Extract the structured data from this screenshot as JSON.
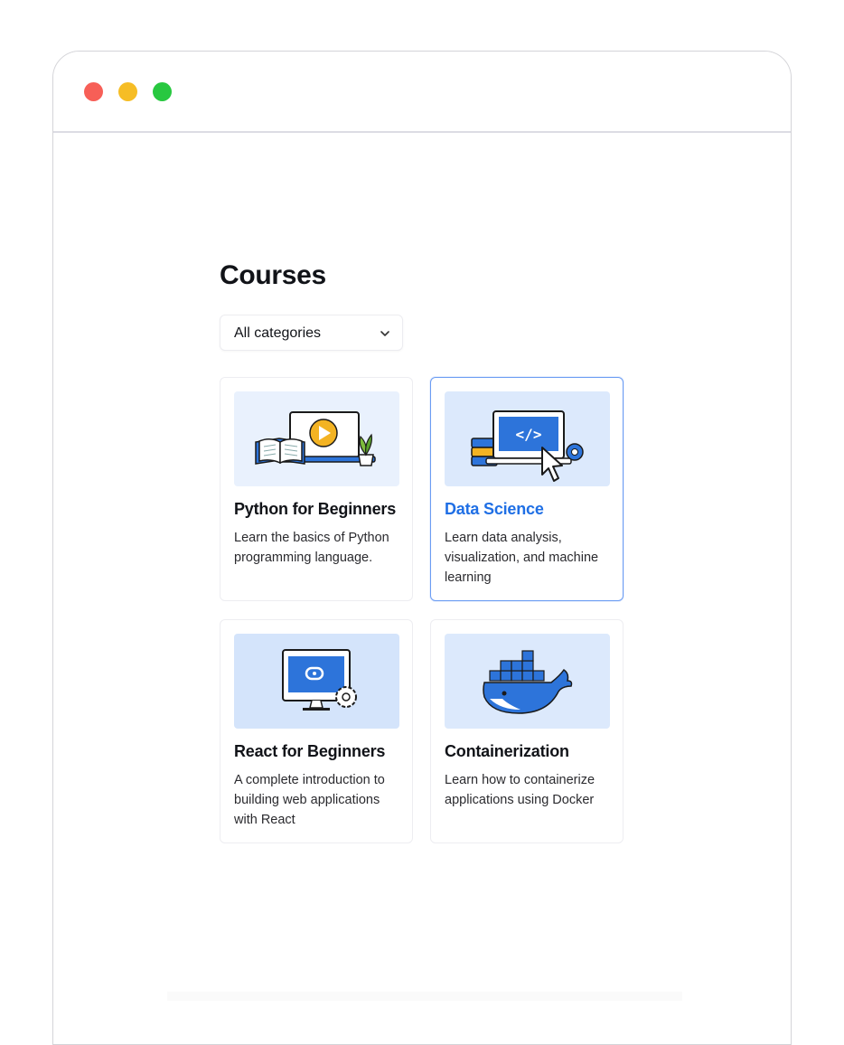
{
  "page": {
    "title": "Courses"
  },
  "filter": {
    "selected": "All categories",
    "icon": "chevron-down-icon"
  },
  "courses": [
    {
      "title": "Python for Beginners",
      "description": "Learn the basics of Python programming language.",
      "icon": "book-video-illustration",
      "active": false
    },
    {
      "title": "Data Science",
      "description": "Learn data analysis, visualization, and machine learning",
      "icon": "code-laptop-illustration",
      "active": true
    },
    {
      "title": "React for Beginners",
      "description": "A complete introduction to building web applications with React",
      "icon": "monitor-gear-illustration",
      "active": false
    },
    {
      "title": "Containerization",
      "description": "Learn how to containerize applications using Docker",
      "icon": "docker-whale-illustration",
      "active": false
    }
  ],
  "colors": {
    "accent": "#1f6fe5",
    "active_border": "#6b9cf3",
    "thumb_light": "#e9f1fd",
    "thumb_blue": "#d4e4fb",
    "traffic_red": "#f75f57",
    "traffic_yellow": "#f6bd25",
    "traffic_green": "#28c840"
  }
}
